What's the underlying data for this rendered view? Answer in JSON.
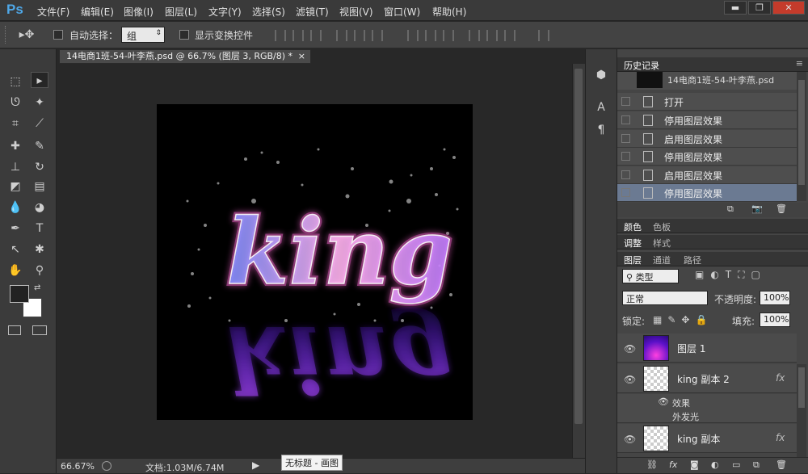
{
  "app": {
    "logo": "Ps"
  },
  "menu": [
    "文件(F)",
    "编辑(E)",
    "图像(I)",
    "图层(L)",
    "文字(Y)",
    "选择(S)",
    "滤镜(T)",
    "视图(V)",
    "窗口(W)",
    "帮助(H)"
  ],
  "window_buttons": {
    "minimize": "▬",
    "restore": "❐",
    "close": "✕"
  },
  "options": {
    "auto_select_label": "自动选择：",
    "auto_select_value": "组",
    "show_transform_label": "显示变换控件"
  },
  "document": {
    "tab_title": "14电商1班-54-叶李燕.psd @ 66.7% (图层 3, RGB/8) *",
    "tab_close": "×",
    "canvas_text": "king"
  },
  "status": {
    "zoom": "66.67%",
    "doc_info": "文档:1.03M/6.74M",
    "tooltip": "无标题 - 画图"
  },
  "history": {
    "tab": "历史记录",
    "snapshot": "14电商1班-54-叶李燕.psd",
    "items": [
      {
        "label": "打开"
      },
      {
        "label": "停用图层效果"
      },
      {
        "label": "启用图层效果"
      },
      {
        "label": "停用图层效果"
      },
      {
        "label": "启用图层效果"
      },
      {
        "label": "停用图层效果"
      }
    ]
  },
  "color_panel": {
    "tabs": [
      "颜色",
      "色板"
    ]
  },
  "adjust_panel": {
    "tabs": [
      "调整",
      "样式"
    ]
  },
  "layers_panel": {
    "tabs": [
      "图层",
      "通道",
      "路径"
    ],
    "filter_kind": "类型",
    "blend_mode": "正常",
    "opacity_label": "不透明度:",
    "opacity": "100%",
    "lock_label": "锁定:",
    "fill_label": "填充:",
    "fill": "100%",
    "layers": [
      {
        "name": "图层 1",
        "fx": ""
      },
      {
        "name": "king 副本 2",
        "fx": "fx"
      },
      {
        "name": "king 副本",
        "fx": "fx"
      }
    ],
    "effects_label": "效果",
    "effect_item": "外发光"
  },
  "colors": {
    "accent": "#4fa8e8",
    "selection": "#6b7a92",
    "glow_pink": "#ff6ad5",
    "glow_blue": "#6f7cff"
  }
}
